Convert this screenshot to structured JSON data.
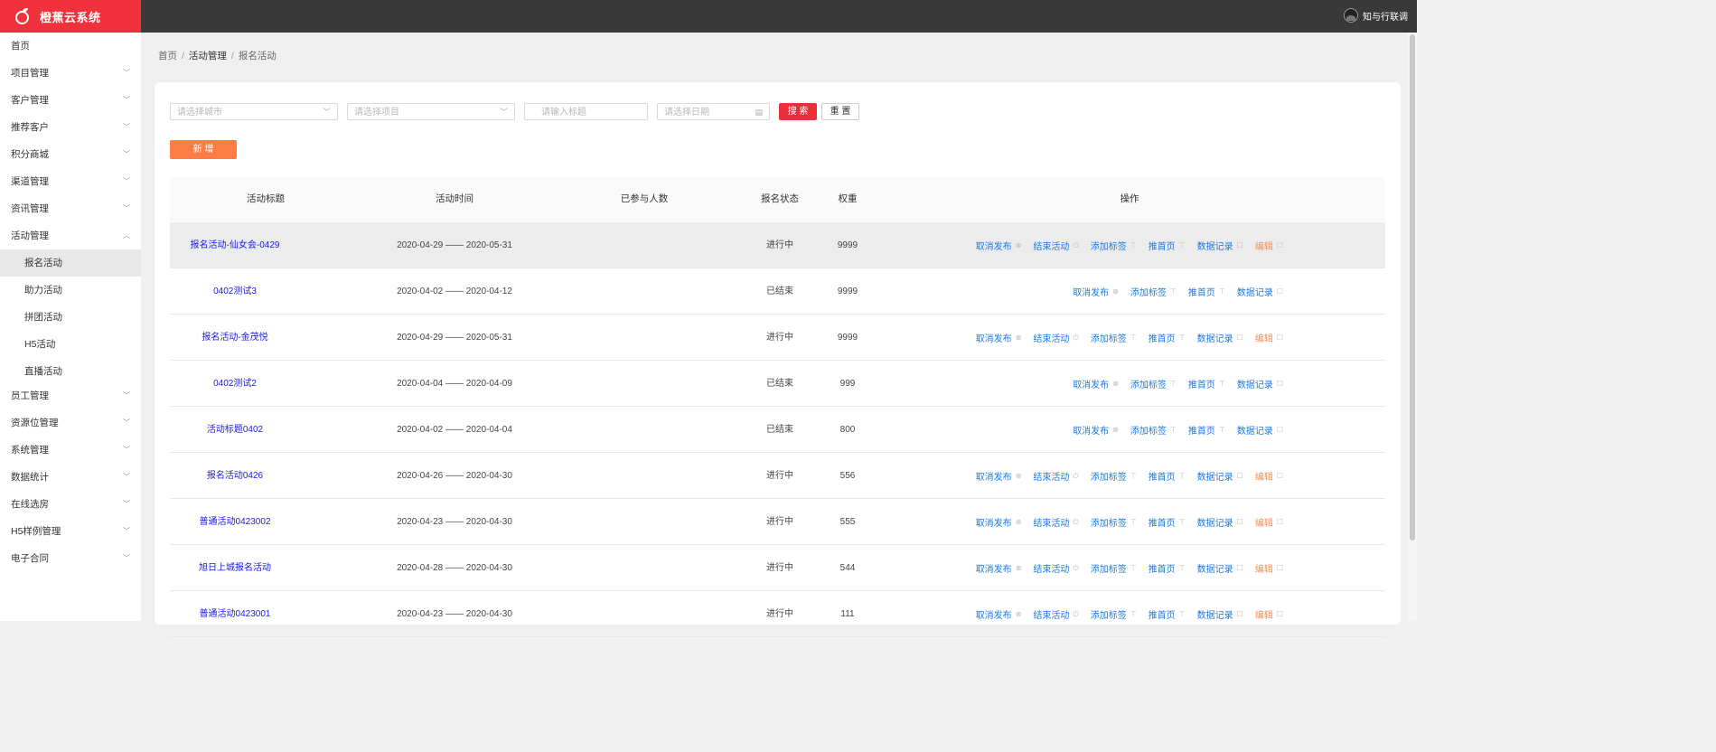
{
  "app": {
    "title": "橙蕉云系统"
  },
  "user": {
    "name": "知与行联调"
  },
  "nav": {
    "items": [
      {
        "label": "首页",
        "chev": ""
      },
      {
        "label": "项目管理",
        "chev": "﹀"
      },
      {
        "label": "客户管理",
        "chev": "﹀"
      },
      {
        "label": "推荐客户",
        "chev": "﹀"
      },
      {
        "label": "积分商城",
        "chev": "﹀"
      },
      {
        "label": "渠道管理",
        "chev": "﹀"
      },
      {
        "label": "资讯管理",
        "chev": "﹀"
      },
      {
        "label": "活动管理",
        "chev": "︿"
      }
    ],
    "sub": [
      "报名活动",
      "助力活动",
      "拼团活动",
      "H5活动",
      "直播活动"
    ],
    "items2": [
      {
        "label": "员工管理",
        "chev": "﹀"
      },
      {
        "label": "资源位管理",
        "chev": "﹀"
      },
      {
        "label": "系统管理",
        "chev": "﹀"
      },
      {
        "label": "数据统计",
        "chev": "﹀"
      },
      {
        "label": "在线选房",
        "chev": "﹀"
      },
      {
        "label": "H5样例管理",
        "chev": "﹀"
      },
      {
        "label": "电子合同",
        "chev": "﹀"
      }
    ]
  },
  "breadcrumb": [
    "首页",
    "活动管理",
    "报名活动"
  ],
  "filters": {
    "city": "请选择城市",
    "project": "请选择项目",
    "title": "请输入标题",
    "date": "请选择日期",
    "search": "搜 索",
    "reset": "重 置"
  },
  "add_label": "新 增",
  "table": {
    "headers": [
      "活动标题",
      "活动时间",
      "已参与人数",
      "报名状态",
      "权重",
      "操作"
    ],
    "rows": [
      {
        "title": "报名活动-仙女会-0429",
        "time": "2020-04-29 —— 2020-05-31",
        "count": "",
        "status": "进行中",
        "weight": "9999"
      },
      {
        "title": "0402测试3",
        "time": "2020-04-02 —— 2020-04-12",
        "count": "",
        "status": "已结束",
        "weight": "9999"
      },
      {
        "title": "报名活动-金茂悦",
        "time": "2020-04-29 —— 2020-05-31",
        "count": "",
        "status": "进行中",
        "weight": "9999"
      },
      {
        "title": "0402测试2",
        "time": "2020-04-04 —— 2020-04-09",
        "count": "",
        "status": "已结束",
        "weight": "999"
      },
      {
        "title": "活动标题0402",
        "time": "2020-04-02 —— 2020-04-04",
        "count": "",
        "status": "已结束",
        "weight": "800"
      },
      {
        "title": "报名活动0426",
        "time": "2020-04-26 —— 2020-04-30",
        "count": "",
        "status": "进行中",
        "weight": "556"
      },
      {
        "title": "普通活动0423002",
        "time": "2020-04-23 —— 2020-04-30",
        "count": "",
        "status": "进行中",
        "weight": "555"
      },
      {
        "title": "旭日上城报名活动",
        "time": "2020-04-28 —— 2020-04-30",
        "count": "",
        "status": "进行中",
        "weight": "544"
      },
      {
        "title": "普通活动0423001",
        "time": "2020-04-23 —— 2020-04-30",
        "count": "",
        "status": "进行中",
        "weight": "111"
      }
    ],
    "actions": {
      "cancel": "取消发布",
      "end": "结束活动",
      "tag": "添加标签",
      "home": "推首页",
      "data": "数据记录",
      "edit": "编辑"
    }
  },
  "colors": {
    "brand": "#f0303a",
    "link": "#1a7ae6",
    "title_link": "#1a1ae6",
    "edit": "#ff8c4c",
    "add": "#ff7d45"
  }
}
